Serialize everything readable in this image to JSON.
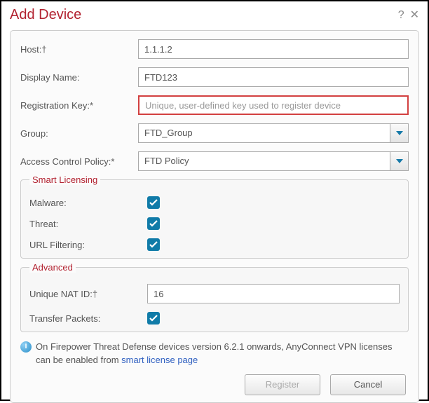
{
  "title": "Add Device",
  "fields": {
    "host": {
      "label": "Host:†",
      "value": "1.1.1.2"
    },
    "display_name": {
      "label": "Display Name:",
      "value": "FTD123"
    },
    "reg_key": {
      "label": "Registration Key:*",
      "placeholder": "Unique, user-defined key used to register device",
      "value": ""
    },
    "group": {
      "label": "Group:",
      "value": "FTD_Group"
    },
    "acp": {
      "label": "Access Control Policy:*",
      "value": "FTD Policy"
    }
  },
  "smart_licensing": {
    "legend": "Smart Licensing",
    "malware": {
      "label": "Malware:",
      "checked": true
    },
    "threat": {
      "label": "Threat:",
      "checked": true
    },
    "url_filtering": {
      "label": "URL Filtering:",
      "checked": true
    }
  },
  "advanced": {
    "legend": "Advanced",
    "nat_id": {
      "label": "Unique NAT ID:†",
      "value": "16"
    },
    "transfer_packets": {
      "label": "Transfer Packets:",
      "checked": true
    }
  },
  "note": {
    "text_before": "On Firepower Threat Defense devices version 6.2.1 onwards, AnyConnect VPN licenses can be enabled from ",
    "link_text": "smart license page"
  },
  "buttons": {
    "register": "Register",
    "cancel": "Cancel"
  }
}
